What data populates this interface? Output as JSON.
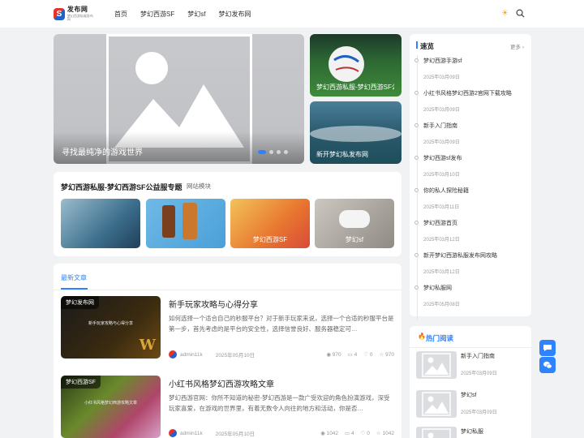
{
  "header": {
    "logo_text": "发布网",
    "logo_sub": "梦幻西游私服发布网",
    "nav": [
      "首页",
      "梦幻西游SF",
      "梦幻sf",
      "梦幻发布网"
    ]
  },
  "banner": {
    "caption": "寻找最纯净的游戏世界",
    "side": [
      {
        "caption": "梦幻西游私服-梦幻西游SF公益服专题"
      },
      {
        "caption": "新开梦幻私发布网"
      }
    ]
  },
  "topic": {
    "title": "梦幻西游私服-梦幻西游SF公益服专题",
    "tag": "网站模块",
    "tiles": [
      {
        "caption": ""
      },
      {
        "caption": ""
      },
      {
        "caption": "梦幻西游SF"
      },
      {
        "caption": "梦幻sf"
      }
    ]
  },
  "news": {
    "tab": "最新文章",
    "articles": [
      {
        "label": "梦幻发布网",
        "overlay": "新手玩家攻略与心得分享",
        "title": "新手玩家攻略与心得分享",
        "desc": "如何选择一个适合自己的秒服平台？对于新手玩家来说，选择一个合适的秒服平台是第一步，首先考虑的是平台的安全性，选择信誉良好、服务器稳定可…",
        "author": "admin11k",
        "date": "2025年05月10日",
        "views": "970",
        "comments": "4",
        "likes": "0",
        "stars": "970"
      },
      {
        "label": "梦幻西游SF",
        "overlay": "小红书风格梦幻西游攻略文章",
        "title": "小红书风格梦幻西游攻略文章",
        "desc": "梦幻西游官网：你所不知道的秘密-梦幻西游是一款广受欢迎的角色扮演游戏，深受玩家喜爱，在游戏的世界里，有着无数令人向往的地方和活动，你是否…",
        "author": "admin11k",
        "date": "2025年05月10日",
        "views": "1042",
        "comments": "4",
        "likes": "0",
        "stars": "1042"
      }
    ]
  },
  "quick": {
    "title": "速览",
    "more": "更多 ›",
    "items": [
      {
        "title": "梦幻西游手游sf",
        "date": "2025年03月09日"
      },
      {
        "title": "小红书风格梦幻西游2官网下载攻略",
        "date": "2025年03月09日"
      },
      {
        "title": "新手入门指南",
        "date": "2025年03月09日"
      },
      {
        "title": "梦幻西游sf发布",
        "date": "2025年03月10日"
      },
      {
        "title": "你的私人探险秘籍",
        "date": "2025年03月11日"
      },
      {
        "title": "梦幻西游首页",
        "date": "2025年03月12日"
      },
      {
        "title": "新开梦幻西游私服发布网攻略",
        "date": "2025年03月12日"
      },
      {
        "title": "梦幻私服网",
        "date": "2025年05月08日"
      }
    ]
  },
  "hot": {
    "title": "热门阅读",
    "items": [
      {
        "title": "新手入门指南",
        "date": "2025年03月09日"
      },
      {
        "title": "梦幻sf",
        "date": "2025年03月09日"
      },
      {
        "title": "梦幻私服",
        "date": ""
      }
    ]
  },
  "colors": {
    "accent": "#2f83ff",
    "brand_red": "#e5322d",
    "brand_blue": "#2361c8"
  }
}
